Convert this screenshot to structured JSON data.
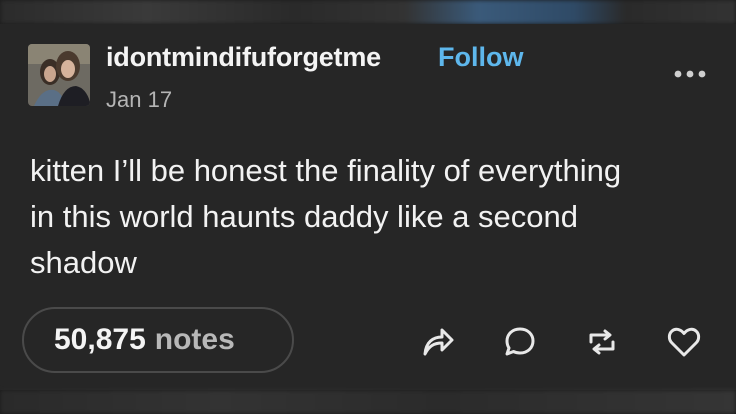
{
  "post": {
    "username": "idontmindifuforgetme",
    "follow_label": "Follow",
    "date": "Jan 17",
    "body_lines": [
      "kitten I’ll be honest the finality of everything",
      "in this world haunts daddy like a second",
      "shadow"
    ],
    "notes_count": "50,875",
    "notes_label": "notes"
  },
  "icons": {
    "more": "more-options-icon",
    "share": "share-icon",
    "reply": "reply-icon",
    "reblog": "reblog-icon",
    "like": "heart-icon"
  },
  "colors": {
    "background": "#262626",
    "accent": "#5eb7ec",
    "text": "#f2f2f2",
    "muted": "#b5b5b5"
  }
}
